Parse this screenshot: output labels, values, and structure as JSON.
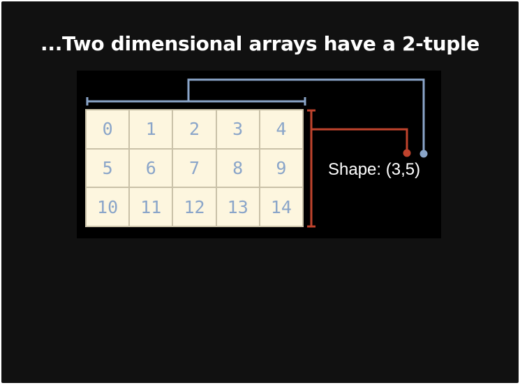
{
  "slide": {
    "title": "...Two dimensional arrays have a 2-tuple",
    "shape_label": "Shape: (3,5)"
  },
  "array": {
    "rows": 3,
    "cols": 5,
    "cells": [
      [
        "0",
        "1",
        "2",
        "3",
        "4"
      ],
      [
        "5",
        "6",
        "7",
        "8",
        "9"
      ],
      [
        "10",
        "11",
        "12",
        "13",
        "14"
      ]
    ]
  },
  "colors": {
    "rows_bracket": "#c0432d",
    "cols_bracket": "#8aa5c9",
    "cell_background": "#fdf6df",
    "cell_text": "#8aa5c9"
  }
}
